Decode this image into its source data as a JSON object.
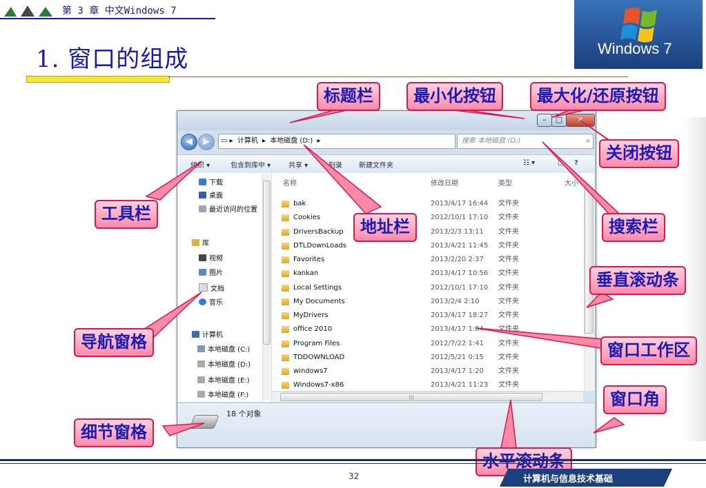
{
  "slide": {
    "chapter": "第 3 章  中文Windows 7",
    "title": "1.  窗口的组成",
    "logo_text": "Windows 7",
    "page_number": "32",
    "footer_banner": "计算机与信息技术基础"
  },
  "explorer": {
    "address_crumbs": [
      "计算机",
      "本地磁盘 (D:)"
    ],
    "search_placeholder": "搜索 本地磁盘 (D:)",
    "toolbar": [
      "组织 ▾",
      "包含到库中 ▾",
      "共享 ▾",
      "刻录",
      "新建文件夹"
    ],
    "nav_items": [
      "下载",
      "桌面",
      "最近访问的位置",
      "库",
      "视频",
      "图片",
      "文档",
      "音乐",
      "计算机",
      "本地磁盘 (C:)",
      "本地磁盘 (D:)",
      "本地磁盘 (E:)",
      "本地磁盘 (F:)"
    ],
    "columns": [
      "名称",
      "修改日期",
      "类型",
      "大小"
    ],
    "files": [
      {
        "name": "bak",
        "date": "2013/4/17 16:44",
        "type": "文件夹"
      },
      {
        "name": "Cookies",
        "date": "2012/10/1 17:10",
        "type": "文件夹"
      },
      {
        "name": "DriversBackup",
        "date": "2013/2/3 13:11",
        "type": "文件夹"
      },
      {
        "name": "DTLDownLoads",
        "date": "2013/4/21 11:45",
        "type": "文件夹"
      },
      {
        "name": "Favorites",
        "date": "2013/2/20 2:37",
        "type": "文件夹"
      },
      {
        "name": "kankan",
        "date": "2013/4/17 10:56",
        "type": "文件夹"
      },
      {
        "name": "Local Settings",
        "date": "2012/10/1 17:10",
        "type": "文件夹"
      },
      {
        "name": "My Documents",
        "date": "2013/2/4 2:10",
        "type": "文件夹"
      },
      {
        "name": "MyDrivers",
        "date": "2013/4/17 18:27",
        "type": "文件夹"
      },
      {
        "name": "office 2010",
        "date": "2013/4/17 1:04",
        "type": "文件夹"
      },
      {
        "name": "Program Files",
        "date": "2012/7/22 1:41",
        "type": "文件夹"
      },
      {
        "name": "TDDOWNLOAD",
        "date": "2012/5/21 0:15",
        "type": "文件夹"
      },
      {
        "name": "windows7",
        "date": "2013/4/17 1:20",
        "type": "文件夹"
      },
      {
        "name": "Windows7-x86",
        "date": "2013/4/21 11:23",
        "type": "文件夹"
      }
    ],
    "details_text": "18 个对象"
  },
  "callouts": {
    "title_bar": "标题栏",
    "minimize": "最小化按钮",
    "maximize_restore": "最大化/还原按钮",
    "close": "关闭按钮",
    "toolbar": "工具栏",
    "address_bar": "地址栏",
    "search_bar": "搜索栏",
    "vertical_scroll": "垂直滚动条",
    "nav_pane": "导航窗格",
    "work_area": "窗口工作区",
    "window_corner": "窗口角",
    "details_pane": "细节窗格",
    "horizontal_scroll": "水平滚动条"
  },
  "colors": {
    "callout_fill": "#ff8aa8",
    "callout_border": "#d8184f",
    "callout_text": "#1a1ab5",
    "title_text": "#1a1ab5"
  }
}
